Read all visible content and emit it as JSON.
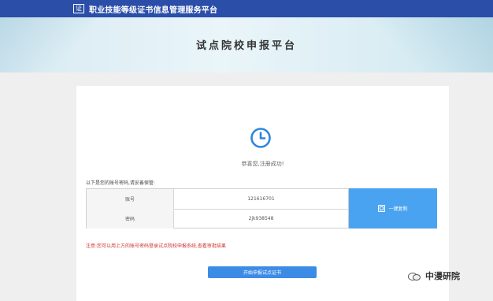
{
  "header": {
    "logo_glyph": "证",
    "site_title": "职业技能等级证书信息管理服务平台"
  },
  "banner": {
    "title": "试点院校申报平台"
  },
  "registration": {
    "success_message": "恭喜您,注册成功!",
    "notice": "以下是您的账号密码,请妥善保管:",
    "account_label": "账号",
    "account_value": "121616701",
    "password_label": "密码",
    "password_value": "2jk938548",
    "copy_button_label": "一键复制",
    "warning": "注意:您可以用上方的账号密码登录试点院校申报系统,查看审批结果",
    "start_button_label": "开始申报试点证书"
  },
  "watermark": {
    "text": "中漫研院"
  },
  "colors": {
    "header_bg": "#2b4ea8",
    "primary_button": "#3c8ce6",
    "copy_button": "#4aa3f0",
    "warning_text": "#d0312d"
  }
}
